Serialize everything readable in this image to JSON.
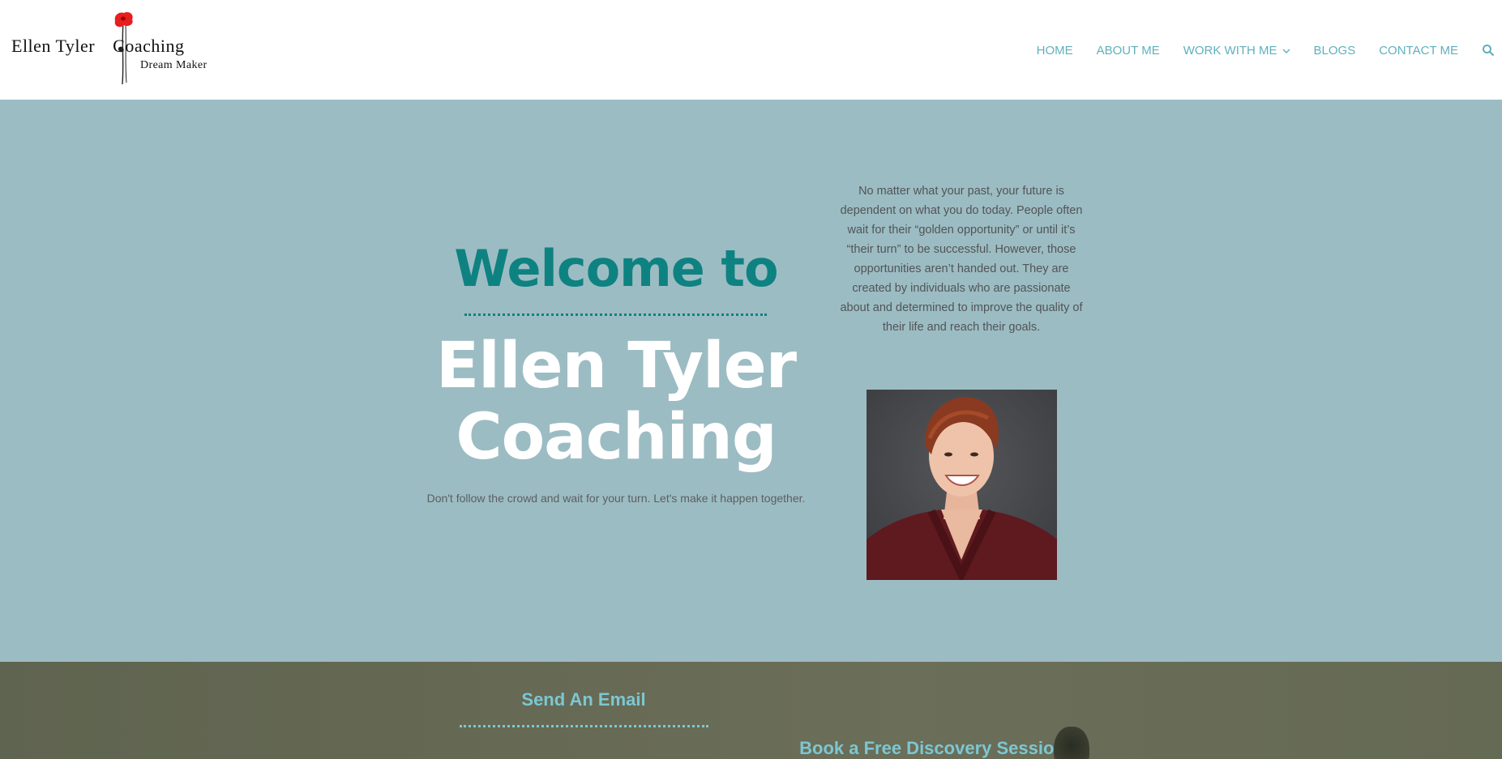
{
  "header": {
    "logo": {
      "name_part1": "Ellen Tyler",
      "name_part2": "Coaching",
      "tagline": "Dream Maker"
    },
    "nav": [
      {
        "label": "HOME"
      },
      {
        "label": "ABOUT ME"
      },
      {
        "label": "WORK WITH ME",
        "has_dropdown": true
      },
      {
        "label": "BLOGS"
      },
      {
        "label": "CONTACT ME"
      }
    ],
    "search_icon": "search-icon"
  },
  "hero": {
    "welcome": "Welcome to",
    "title_line1": "Ellen Tyler",
    "title_line2": "Coaching",
    "tagline": "Don't follow the crowd and wait for your turn. Let's make it happen together.",
    "quote": "No matter what your past, your future is dependent on what you do today. People often wait for their “golden opportunity” or until it’s “their turn” to be successful. However, those opportunities aren’t handed out. They are created by individuals who are passionate about and determined to improve the quality of their life and reach their goals."
  },
  "bottom": {
    "send_email": "Send An Email",
    "book_session": "Book a Free Discovery Session"
  },
  "colors": {
    "hero_bg": "#9cbcc3",
    "accent_teal": "#0e8281",
    "nav_text": "#5fb0bd",
    "bottom_band": "#656953",
    "bottom_heading": "#7cc7d3"
  }
}
